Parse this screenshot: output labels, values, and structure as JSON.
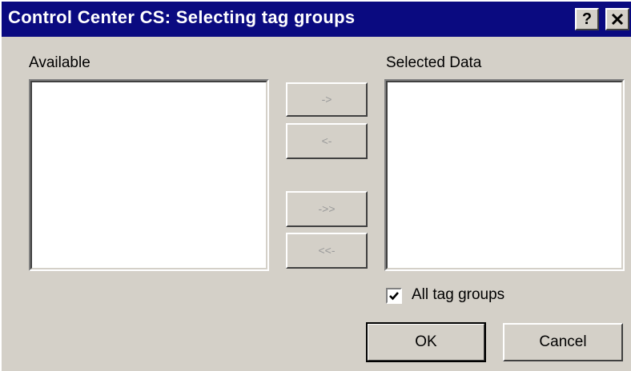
{
  "window": {
    "title": "Control Center CS: Selecting tag groups",
    "help_label": "?",
    "close_label": "✕"
  },
  "available": {
    "label": "Available",
    "items": []
  },
  "selected": {
    "label": "Selected Data",
    "items": []
  },
  "transfer_buttons": {
    "add_label": "->",
    "remove_label": "<-",
    "add_all_label": "->>",
    "remove_all_label": "<<-"
  },
  "all_tag_groups": {
    "label": "All tag groups",
    "checked": true
  },
  "footer": {
    "ok_label": "OK",
    "cancel_label": "Cancel"
  }
}
